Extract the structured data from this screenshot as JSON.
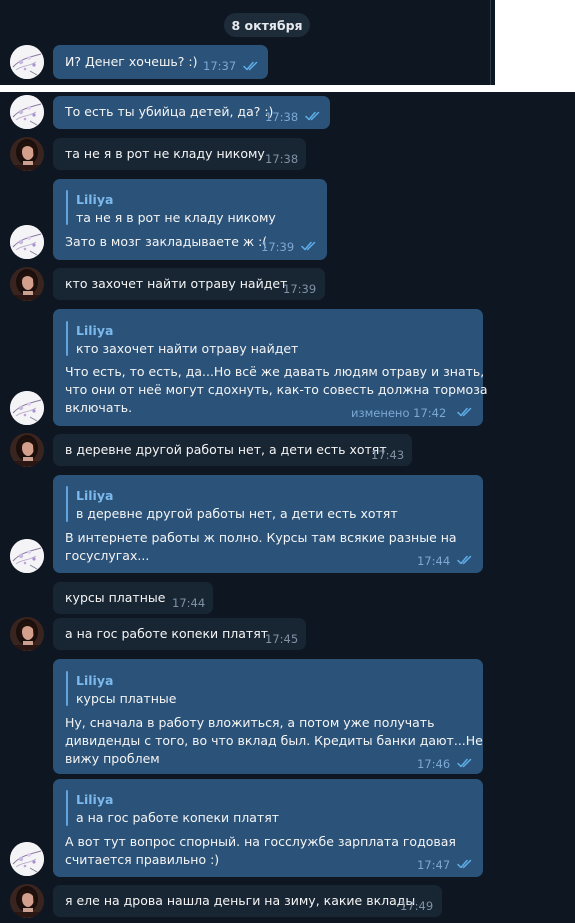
{
  "date_divider": "8 октября",
  "quote_author": "Liliya",
  "messages": [
    {
      "text": "И? Денег хочешь? :)",
      "time": "17:37"
    },
    {
      "text": "То есть ты убийца детей, да? :)",
      "time": "17:38"
    },
    {
      "text": "та не я в рот не кладу  никому",
      "time": "17:38"
    },
    {
      "quote": "та не я в рот не кладу  никому",
      "text": "Зато в мозг закладываете ж :(",
      "time": "17:39"
    },
    {
      "text": "кто захочет найти отраву найдет",
      "time": "17:39"
    },
    {
      "quote": "кто захочет найти отраву найдет",
      "lines": [
        "Что есть, то есть, да...Но всё же давать людям отраву и знать,",
        "что они от неё могут сдохнуть, как-то совесть должна тормоза",
        "включать."
      ],
      "time": "изменено 17:42"
    },
    {
      "text": "в деревне другой работы нет, а дети есть хотят",
      "time": "17:43"
    },
    {
      "quote": "в деревне другой работы нет, а дети есть хотят",
      "lines": [
        "В интернете работы ж полно. Курсы там всякие разные на",
        "госуслугах..."
      ],
      "time": "17:44"
    },
    {
      "text": "курсы платные",
      "time": "17:44"
    },
    {
      "text": "а на гос работе копеки платят",
      "time": "17:45"
    },
    {
      "quote": "курсы платные",
      "lines": [
        "Ну, сначала в работу вложиться, а потом уже получать",
        "дивиденды с того, во что вклад был. Кредиты банки дают...Не",
        "вижу проблем"
      ],
      "time": "17:46"
    },
    {
      "quote": "а на гос работе копеки платят",
      "lines": [
        "А вот тут вопрос спорный. на госслужбе зарплата годовая",
        "считается правильно :)"
      ],
      "time": "17:47"
    },
    {
      "text": "я еле на дрова нашла деньги на зиму, какие вклады",
      "time": "17:49"
    }
  ],
  "colors": {
    "background": "#0e1621",
    "outgoing_bubble": "#2b5278",
    "incoming_bubble": "#182533",
    "quote_accent": "#7cb9ec",
    "read_check": "#5eaee8"
  },
  "icons": {
    "my_avatar": "sketch-avatar",
    "her_avatar": "photo-avatar",
    "read_status": "double-check-icon"
  }
}
